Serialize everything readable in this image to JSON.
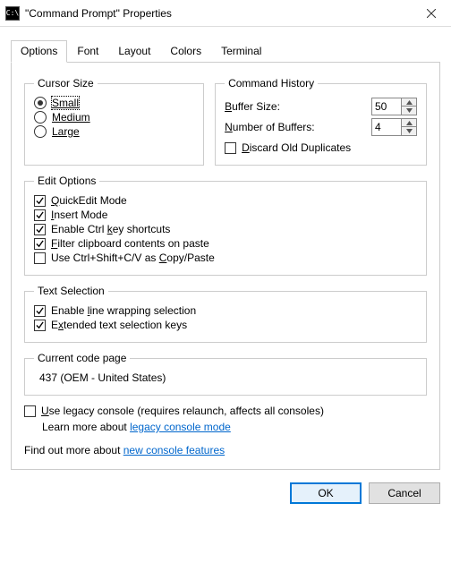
{
  "window": {
    "title": "\"Command Prompt\" Properties"
  },
  "tabs": {
    "options": "Options",
    "font": "Font",
    "layout": "Layout",
    "colors": "Colors",
    "terminal": "Terminal"
  },
  "cursor": {
    "legend": "Cursor Size",
    "small": "Small",
    "medium": "Medium",
    "large": "Large"
  },
  "history": {
    "legend": "Command History",
    "buffer_label_pre": "B",
    "buffer_label_rest": "uffer Size:",
    "buffer_value": "50",
    "num_label_pre": "N",
    "num_label_rest": "umber of Buffers:",
    "num_value": "4",
    "discard_pre": "D",
    "discard_rest": "iscard Old Duplicates"
  },
  "edit": {
    "legend": "Edit Options",
    "quickedit_pre": "Q",
    "quickedit_rest": "uickEdit Mode",
    "insert_pre": "I",
    "insert_rest": "nsert Mode",
    "ctrl_pre": "Enable Ctrl ",
    "ctrl_u": "k",
    "ctrl_rest": "ey shortcuts",
    "filter_pre": "F",
    "filter_rest": "ilter clipboard contents on paste",
    "usectrl_pre": "Use Ctrl+Shift+C/V as ",
    "usectrl_u": "C",
    "usectrl_rest": "opy/Paste"
  },
  "textsel": {
    "legend": "Text Selection",
    "linewrap_pre": "Enable ",
    "linewrap_u": "l",
    "linewrap_rest": "ine wrapping selection",
    "ext_pre": "E",
    "ext_u": "x",
    "ext_rest": "tended text selection keys"
  },
  "codepage": {
    "legend": "Current code page",
    "value": "437  (OEM - United States)"
  },
  "legacy": {
    "label_pre": "U",
    "label_rest": "se legacy console (requires relaunch, affects all consoles)",
    "learn_pre": "Learn more about ",
    "learn_link": "legacy console mode"
  },
  "findout": {
    "pre": "Find out more about ",
    "link": "new console features"
  },
  "buttons": {
    "ok": "OK",
    "cancel": "Cancel"
  }
}
